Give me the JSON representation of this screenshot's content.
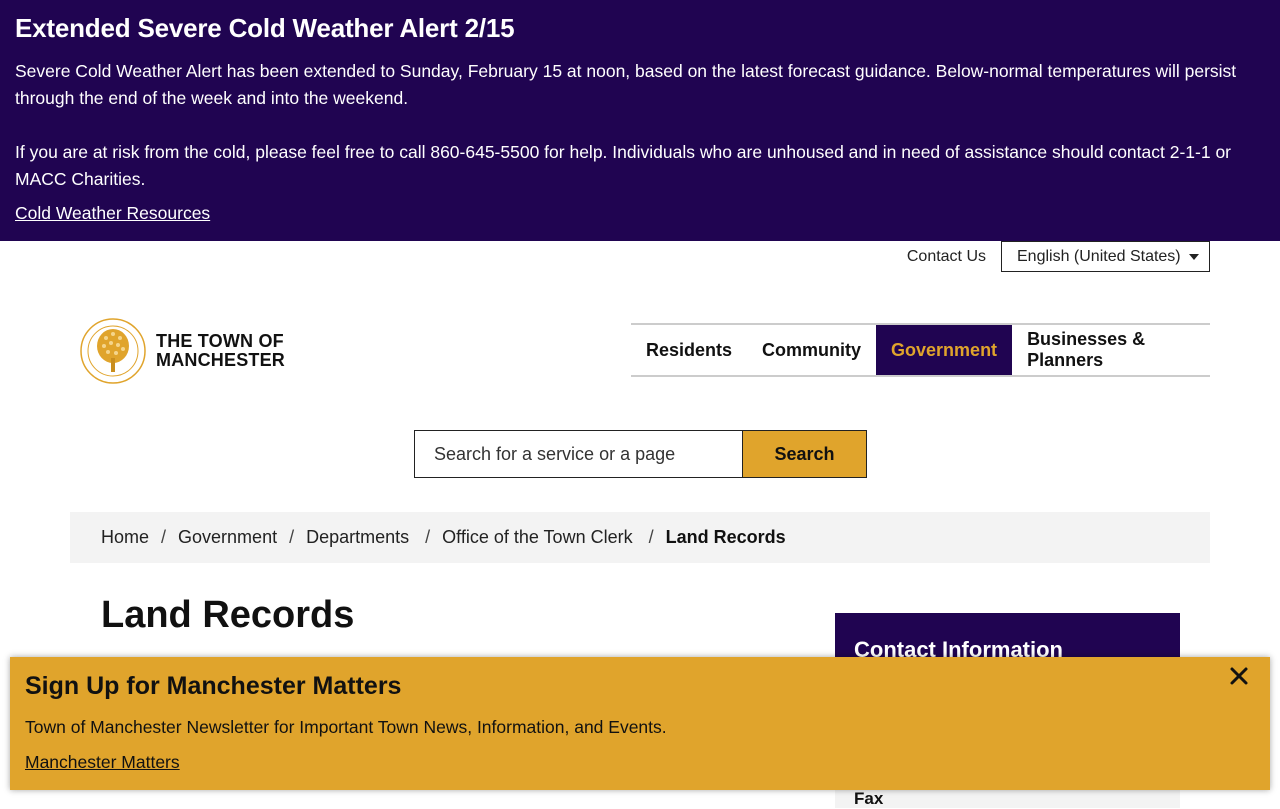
{
  "alert": {
    "title": "Extended Severe Cold Weather Alert 2/15",
    "paragraph1": "Severe Cold Weather Alert has been extended to Sunday, February 15 at noon, based on the latest forecast guidance. Below-normal temperatures will persist through the end of the week and into the weekend.",
    "paragraph2": "If you are at risk from the cold, please feel free to call 860-645-5500 for help. Individuals who are unhoused and in need of assistance should contact 2-1-1 or MACC Charities.",
    "link": "Cold Weather Resources",
    "background_color": "#200451"
  },
  "utility": {
    "contact_us": "Contact Us",
    "language": "English (United States)"
  },
  "logo": {
    "line1": "THE TOWN OF",
    "line2": "MANCHESTER",
    "icon": "town-seal-tree-icon"
  },
  "nav": {
    "items": [
      {
        "label": "Residents"
      },
      {
        "label": "Community"
      },
      {
        "label": "Government",
        "active": true
      },
      {
        "label": "Businesses & Planners"
      }
    ]
  },
  "search": {
    "placeholder": "Search for a service or a page",
    "button": "Search"
  },
  "breadcrumb": {
    "items": [
      "Home",
      "Government",
      "Departments",
      "Office of the Town Clerk"
    ],
    "current": "Land Records",
    "separator": "/"
  },
  "page": {
    "title": "Land Records"
  },
  "sidebar": {
    "card_title": "Contact Information",
    "fax_label": "Fax"
  },
  "popup": {
    "title": "Sign Up for Manchester Matters",
    "text": "Town of Manchester Newsletter for Important Town News, Information, and Events.",
    "link": "Manchester Matters",
    "close_icon": "close-icon",
    "background_color": "#e0a42c"
  },
  "colors": {
    "brand_purple": "#200451",
    "brand_gold": "#e0a42c"
  }
}
